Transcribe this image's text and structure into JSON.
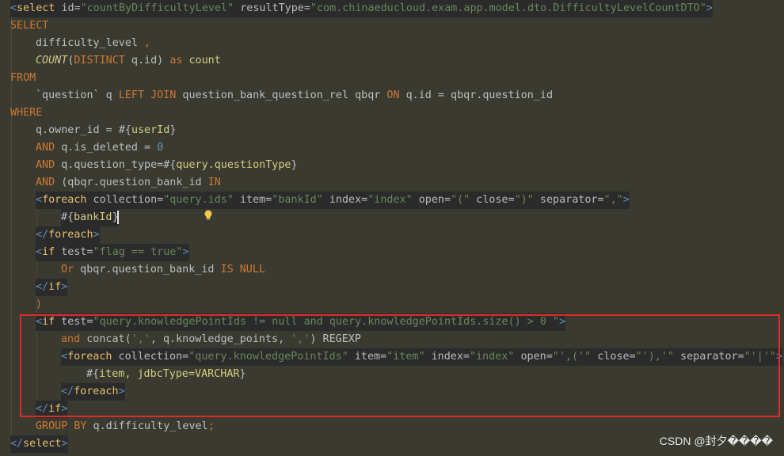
{
  "editor": {
    "lines": [
      {
        "highlight": true,
        "indent": 0,
        "segments": [
          {
            "t": "<",
            "c": "br"
          },
          {
            "t": "select",
            "c": "tag"
          },
          {
            "t": " id=",
            "c": "attr"
          },
          {
            "t": "\"countByDifficultyLevel\"",
            "c": "val"
          },
          {
            "t": " resultType=",
            "c": "attr"
          },
          {
            "t": "\"com.chinaeducloud.exam.app.model.dto.DifficultyLevelCountDTO\"",
            "c": "val"
          },
          {
            "t": ">",
            "c": "br"
          }
        ]
      },
      {
        "highlight": false,
        "indent": 0,
        "segments": [
          {
            "t": "SELECT",
            "c": "kw"
          }
        ]
      },
      {
        "highlight": false,
        "indent": 1,
        "segments": [
          {
            "t": "difficulty_level",
            "c": "plain"
          },
          {
            "t": " ,",
            "c": "kw"
          }
        ]
      },
      {
        "highlight": false,
        "indent": 1,
        "segments": [
          {
            "t": "COUNT",
            "c": "fn"
          },
          {
            "t": "(",
            "c": "plain"
          },
          {
            "t": "DISTINCT",
            "c": "kw"
          },
          {
            "t": " q.id) ",
            "c": "plain"
          },
          {
            "t": "as",
            "c": "kw"
          },
          {
            "t": " count",
            "c": "expr"
          }
        ]
      },
      {
        "highlight": false,
        "indent": 0,
        "segments": [
          {
            "t": "FROM",
            "c": "kw"
          }
        ]
      },
      {
        "highlight": false,
        "indent": 1,
        "segments": [
          {
            "t": "`question` q ",
            "c": "plain"
          },
          {
            "t": "LEFT JOIN",
            "c": "kw"
          },
          {
            "t": " question_bank_question_rel qbqr ",
            "c": "plain"
          },
          {
            "t": "ON",
            "c": "kw"
          },
          {
            "t": " q.id = qbqr.question_id",
            "c": "plain"
          }
        ]
      },
      {
        "highlight": false,
        "indent": 0,
        "segments": [
          {
            "t": "WHERE",
            "c": "kw"
          }
        ]
      },
      {
        "highlight": false,
        "indent": 1,
        "segments": [
          {
            "t": "q.owner_id = ",
            "c": "plain"
          },
          {
            "t": "#{",
            "c": "plain"
          },
          {
            "t": "userId",
            "c": "expr"
          },
          {
            "t": "}",
            "c": "plain"
          }
        ]
      },
      {
        "highlight": false,
        "indent": 1,
        "segments": [
          {
            "t": "AND",
            "c": "kw"
          },
          {
            "t": " q.is_deleted = ",
            "c": "plain"
          },
          {
            "t": "0",
            "c": "num"
          }
        ]
      },
      {
        "highlight": false,
        "indent": 1,
        "segments": [
          {
            "t": "AND",
            "c": "kw"
          },
          {
            "t": " q.question_type=",
            "c": "plain"
          },
          {
            "t": "#{",
            "c": "plain"
          },
          {
            "t": "query.questionType",
            "c": "expr"
          },
          {
            "t": "}",
            "c": "plain"
          }
        ]
      },
      {
        "highlight": false,
        "indent": 1,
        "segments": [
          {
            "t": "AND",
            "c": "kw"
          },
          {
            "t": " (qbqr.question_bank_id ",
            "c": "plain"
          },
          {
            "t": "IN",
            "c": "kw"
          }
        ]
      },
      {
        "highlight": true,
        "indent": 1,
        "segments": [
          {
            "t": "<",
            "c": "br"
          },
          {
            "t": "foreach",
            "c": "tag"
          },
          {
            "t": " collection=",
            "c": "attr"
          },
          {
            "t": "\"query.ids\"",
            "c": "val"
          },
          {
            "t": " item=",
            "c": "attr"
          },
          {
            "t": "\"bankId\"",
            "c": "val"
          },
          {
            "t": " index=",
            "c": "attr"
          },
          {
            "t": "\"index\"",
            "c": "val"
          },
          {
            "t": " open=",
            "c": "attr"
          },
          {
            "t": "\"(\"",
            "c": "val"
          },
          {
            "t": " close=",
            "c": "attr"
          },
          {
            "t": "\")\"",
            "c": "val"
          },
          {
            "t": " separator=",
            "c": "attr"
          },
          {
            "t": "\",\"",
            "c": "val"
          },
          {
            "t": ">",
            "c": "br"
          }
        ]
      },
      {
        "highlight": true,
        "indent": 2,
        "segments": [
          {
            "t": "#{",
            "c": "plain"
          },
          {
            "t": "bankId",
            "c": "expr"
          },
          {
            "t": "}",
            "c": "plain"
          }
        ]
      },
      {
        "highlight": true,
        "indent": 1,
        "segments": [
          {
            "t": "</",
            "c": "br"
          },
          {
            "t": "foreach",
            "c": "tag"
          },
          {
            "t": ">",
            "c": "br"
          }
        ]
      },
      {
        "highlight": true,
        "indent": 1,
        "segments": [
          {
            "t": "<",
            "c": "br"
          },
          {
            "t": "if",
            "c": "tag"
          },
          {
            "t": " test=",
            "c": "attr"
          },
          {
            "t": "\"flag == true\"",
            "c": "val"
          },
          {
            "t": ">",
            "c": "br"
          }
        ]
      },
      {
        "highlight": false,
        "indent": 2,
        "segments": [
          {
            "t": "Or",
            "c": "kw"
          },
          {
            "t": " qbqr.question_bank_id ",
            "c": "plain"
          },
          {
            "t": "IS NULL",
            "c": "kw"
          }
        ]
      },
      {
        "highlight": true,
        "indent": 1,
        "segments": [
          {
            "t": "</",
            "c": "br"
          },
          {
            "t": "if",
            "c": "tag"
          },
          {
            "t": ">",
            "c": "br"
          }
        ]
      },
      {
        "highlight": false,
        "indent": 1,
        "segments": [
          {
            "t": ")",
            "c": "kw"
          }
        ]
      },
      {
        "highlight": true,
        "indent": 1,
        "segments": [
          {
            "t": "<",
            "c": "br"
          },
          {
            "t": "if",
            "c": "tag"
          },
          {
            "t": " test=",
            "c": "attr"
          },
          {
            "t": "\"query.knowledgePointIds != null and query.knowledgePointIds.size() > 0 \"",
            "c": "val"
          },
          {
            "t": ">",
            "c": "br"
          }
        ]
      },
      {
        "highlight": false,
        "indent": 2,
        "segments": [
          {
            "t": "and",
            "c": "kw"
          },
          {
            "t": " concat(",
            "c": "plain"
          },
          {
            "t": "','",
            "c": "str"
          },
          {
            "t": ", q.knowledge_points, ",
            "c": "plain"
          },
          {
            "t": "','",
            "c": "str"
          },
          {
            "t": ") REGEXP",
            "c": "plain"
          }
        ]
      },
      {
        "highlight": true,
        "indent": 2,
        "segments": [
          {
            "t": "<",
            "c": "br"
          },
          {
            "t": "foreach",
            "c": "tag"
          },
          {
            "t": " collection=",
            "c": "attr"
          },
          {
            "t": "\"query.knowledgePointIds\"",
            "c": "val"
          },
          {
            "t": " item=",
            "c": "attr"
          },
          {
            "t": "\"item\"",
            "c": "val"
          },
          {
            "t": " index=",
            "c": "attr"
          },
          {
            "t": "\"index\"",
            "c": "val"
          },
          {
            "t": " open=",
            "c": "attr"
          },
          {
            "t": "\"',('\"",
            "c": "val"
          },
          {
            "t": " close=",
            "c": "attr"
          },
          {
            "t": "\"'),'\"",
            "c": "val"
          },
          {
            "t": " separator=",
            "c": "attr"
          },
          {
            "t": "\"'|'\"",
            "c": "val"
          },
          {
            "t": ">",
            "c": "br"
          }
        ]
      },
      {
        "highlight": false,
        "indent": 3,
        "segments": [
          {
            "t": "#{",
            "c": "plain"
          },
          {
            "t": "item, jdbcType=VARCHAR",
            "c": "expr"
          },
          {
            "t": "}",
            "c": "plain"
          }
        ]
      },
      {
        "highlight": true,
        "indent": 2,
        "segments": [
          {
            "t": "</",
            "c": "br"
          },
          {
            "t": "foreach",
            "c": "tag"
          },
          {
            "t": ">",
            "c": "br"
          }
        ]
      },
      {
        "highlight": true,
        "indent": 1,
        "segments": [
          {
            "t": "</",
            "c": "br"
          },
          {
            "t": "if",
            "c": "tag"
          },
          {
            "t": ">",
            "c": "br"
          }
        ]
      },
      {
        "highlight": false,
        "indent": 1,
        "segments": [
          {
            "t": "GROUP BY",
            "c": "kw"
          },
          {
            "t": " q.difficulty_level",
            "c": "plain"
          },
          {
            "t": ";",
            "c": "kw"
          }
        ]
      },
      {
        "highlight": true,
        "indent": 0,
        "segments": [
          {
            "t": "</",
            "c": "br"
          },
          {
            "t": "select",
            "c": "tag"
          },
          {
            "t": ">",
            "c": "br"
          }
        ]
      }
    ]
  },
  "icons": {
    "intention_bulb": "lightbulb-icon"
  },
  "colors": {
    "background": "#3a3a30",
    "highlight_box": "#e02a2a",
    "keyword": "#cc7832",
    "string": "#6a8759"
  },
  "watermark": "CSDN @封夕����"
}
